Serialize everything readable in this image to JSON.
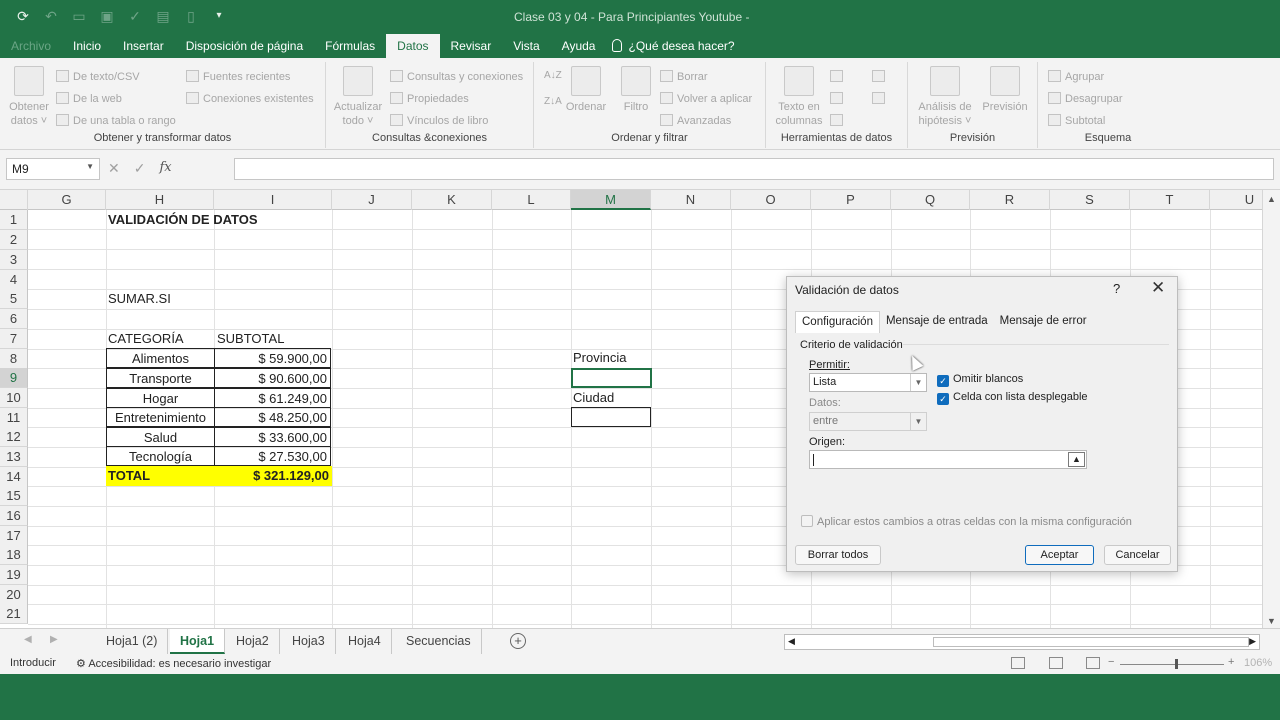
{
  "window": {
    "title": "Clase 03 y 04 - Para Principiantes Youtube -"
  },
  "ribbon_tabs": [
    "Archivo",
    "Inicio",
    "Insertar",
    "Disposición de página",
    "Fórmulas",
    "Datos",
    "Revisar",
    "Vista",
    "Ayuda"
  ],
  "tell_me": "¿Qué desea hacer?",
  "ribbon": {
    "g1": {
      "label": "Obtener y transformar datos",
      "big": "Obtener datos ˅",
      "s1": "De texto/CSV",
      "s2": "De la web",
      "s3": "De una tabla o rango",
      "s4": "Fuentes recientes",
      "s5": "Conexiones existentes"
    },
    "g2": {
      "label": "Consultas &conexiones",
      "big": "Actualizar todo ˅",
      "s1": "Consultas y conexiones",
      "s2": "Propiedades",
      "s3": "Vínculos de libro"
    },
    "g3": {
      "label": "Ordenar y filtrar",
      "b1": "Ordenar",
      "b2": "Filtro",
      "s1": "Borrar",
      "s2": "Volver a aplicar",
      "s3": "Avanzadas"
    },
    "g4": {
      "label": "Herramientas de datos",
      "big": "Texto en columnas"
    },
    "g5": {
      "label": "Previsión",
      "b1": "Análisis de hipótesis ˅",
      "b2": "Previsión"
    },
    "g6": {
      "label": "Esquema",
      "s1": "Agrupar",
      "s2": "Desagrupar",
      "s3": "Subtotal"
    }
  },
  "formula_bar": {
    "name_box": "M9",
    "fx": "fx",
    "value": ""
  },
  "columns": [
    "G",
    "H",
    "I",
    "J",
    "K",
    "L",
    "M",
    "N",
    "O",
    "P",
    "Q",
    "R",
    "S",
    "T",
    "U"
  ],
  "rows": [
    "1",
    "2",
    "3",
    "4",
    "5",
    "6",
    "7",
    "8",
    "9",
    "10",
    "11",
    "12",
    "13",
    "14",
    "15",
    "16",
    "17",
    "18",
    "19",
    "20",
    "21"
  ],
  "sheet": {
    "h1": "VALIDACIÓN DE DATOS",
    "h5": "SUMAR.SI",
    "h7": "CATEGORÍA",
    "i7": "SUBTOTAL",
    "table": [
      {
        "cat": "Alimentos",
        "val": "$ 59.900,00"
      },
      {
        "cat": "Transporte",
        "val": "$ 90.600,00"
      },
      {
        "cat": "Hogar",
        "val": "$ 61.249,00"
      },
      {
        "cat": "Entretenimiento",
        "val": "$ 48.250,00"
      },
      {
        "cat": "Salud",
        "val": "$ 33.600,00"
      },
      {
        "cat": "Tecnología",
        "val": "$ 27.530,00"
      }
    ],
    "total_label": "TOTAL",
    "total_value": "$ 321.129,00",
    "m8": "Provincia",
    "m10": "Ciudad"
  },
  "sheet_tabs": [
    "Hoja1 (2)",
    "Hoja1",
    "Hoja2",
    "Hoja3",
    "Hoja4",
    "Secuencias"
  ],
  "status": {
    "mode": "Introducir",
    "accessibility": "Accesibilidad: es necesario investigar",
    "zoom": "106%"
  },
  "dialog": {
    "title": "Validación de datos",
    "help": "?",
    "close": "✕",
    "tabs": [
      "Configuración",
      "Mensaje de entrada",
      "Mensaje de error"
    ],
    "section": "Criterio de validación",
    "allow_label": "Permitir:",
    "allow_value": "Lista",
    "data_label": "Datos:",
    "data_value": "entre",
    "ignore_blank": "Omitir blancos",
    "in_cell_dropdown": "Celda con lista desplegable",
    "source_label": "Origen:",
    "source_value": "",
    "apply_all": "Aplicar estos cambios a otras celdas con la misma configuración",
    "clear_all": "Borrar todos",
    "ok": "Aceptar",
    "cancel": "Cancelar"
  },
  "colors": {
    "excel_green": "#217346",
    "highlight": "#ffff00",
    "accent_blue": "#0f6cbd"
  }
}
